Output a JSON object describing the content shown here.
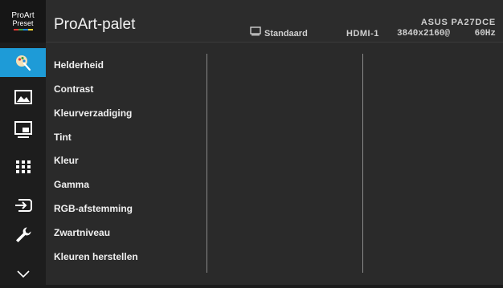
{
  "logo": {
    "line1": "ProArt",
    "line2": "Preset"
  },
  "header": {
    "title": "ProArt-palet",
    "mode": "Standaard",
    "input": "HDMI-1",
    "model": "ASUS PA27DCE",
    "resolution": "3840x2160@",
    "refresh": "60Hz"
  },
  "sidebar": {
    "active_color": "#1e9bd7",
    "items": [
      {
        "icon": "color-palette-icon",
        "active": true
      },
      {
        "icon": "image-icon",
        "active": false
      },
      {
        "icon": "pip-icon",
        "active": false
      },
      {
        "icon": "grid-icon",
        "active": false
      },
      {
        "icon": "input-select-icon",
        "active": false
      },
      {
        "icon": "wrench-icon",
        "active": false
      },
      {
        "icon": "chevron-down-icon",
        "active": false
      }
    ]
  },
  "menu": {
    "items": [
      "Helderheid",
      "Contrast",
      "Kleurverzadiging",
      "Tint",
      "Kleur",
      "Gamma",
      "RGB-afstemming",
      "Zwartniveau",
      "Kleuren herstellen"
    ]
  }
}
